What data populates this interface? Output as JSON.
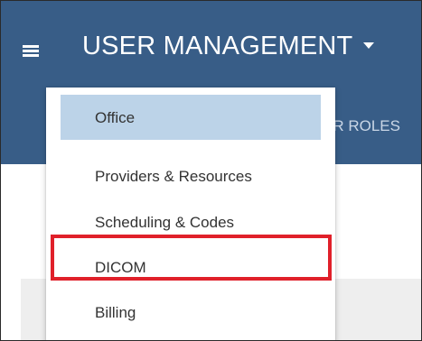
{
  "header": {
    "title": "USER MANAGEMENT",
    "menu_icon": "hamburger-menu-icon",
    "dropdown_icon": "caret-down-icon",
    "partial_tab_label": "ER ROLES"
  },
  "dropdown": {
    "items": [
      {
        "label": "Office",
        "selected": true
      },
      {
        "label": "Providers & Resources",
        "selected": false
      },
      {
        "label": "Scheduling & Codes",
        "selected": false
      },
      {
        "label": "DICOM",
        "selected": false,
        "annotated": true
      },
      {
        "label": "Billing",
        "selected": false
      }
    ]
  },
  "colors": {
    "header_bg": "#385d87",
    "selected_bg": "#bcd3e8",
    "annotation": "#e0202a"
  }
}
